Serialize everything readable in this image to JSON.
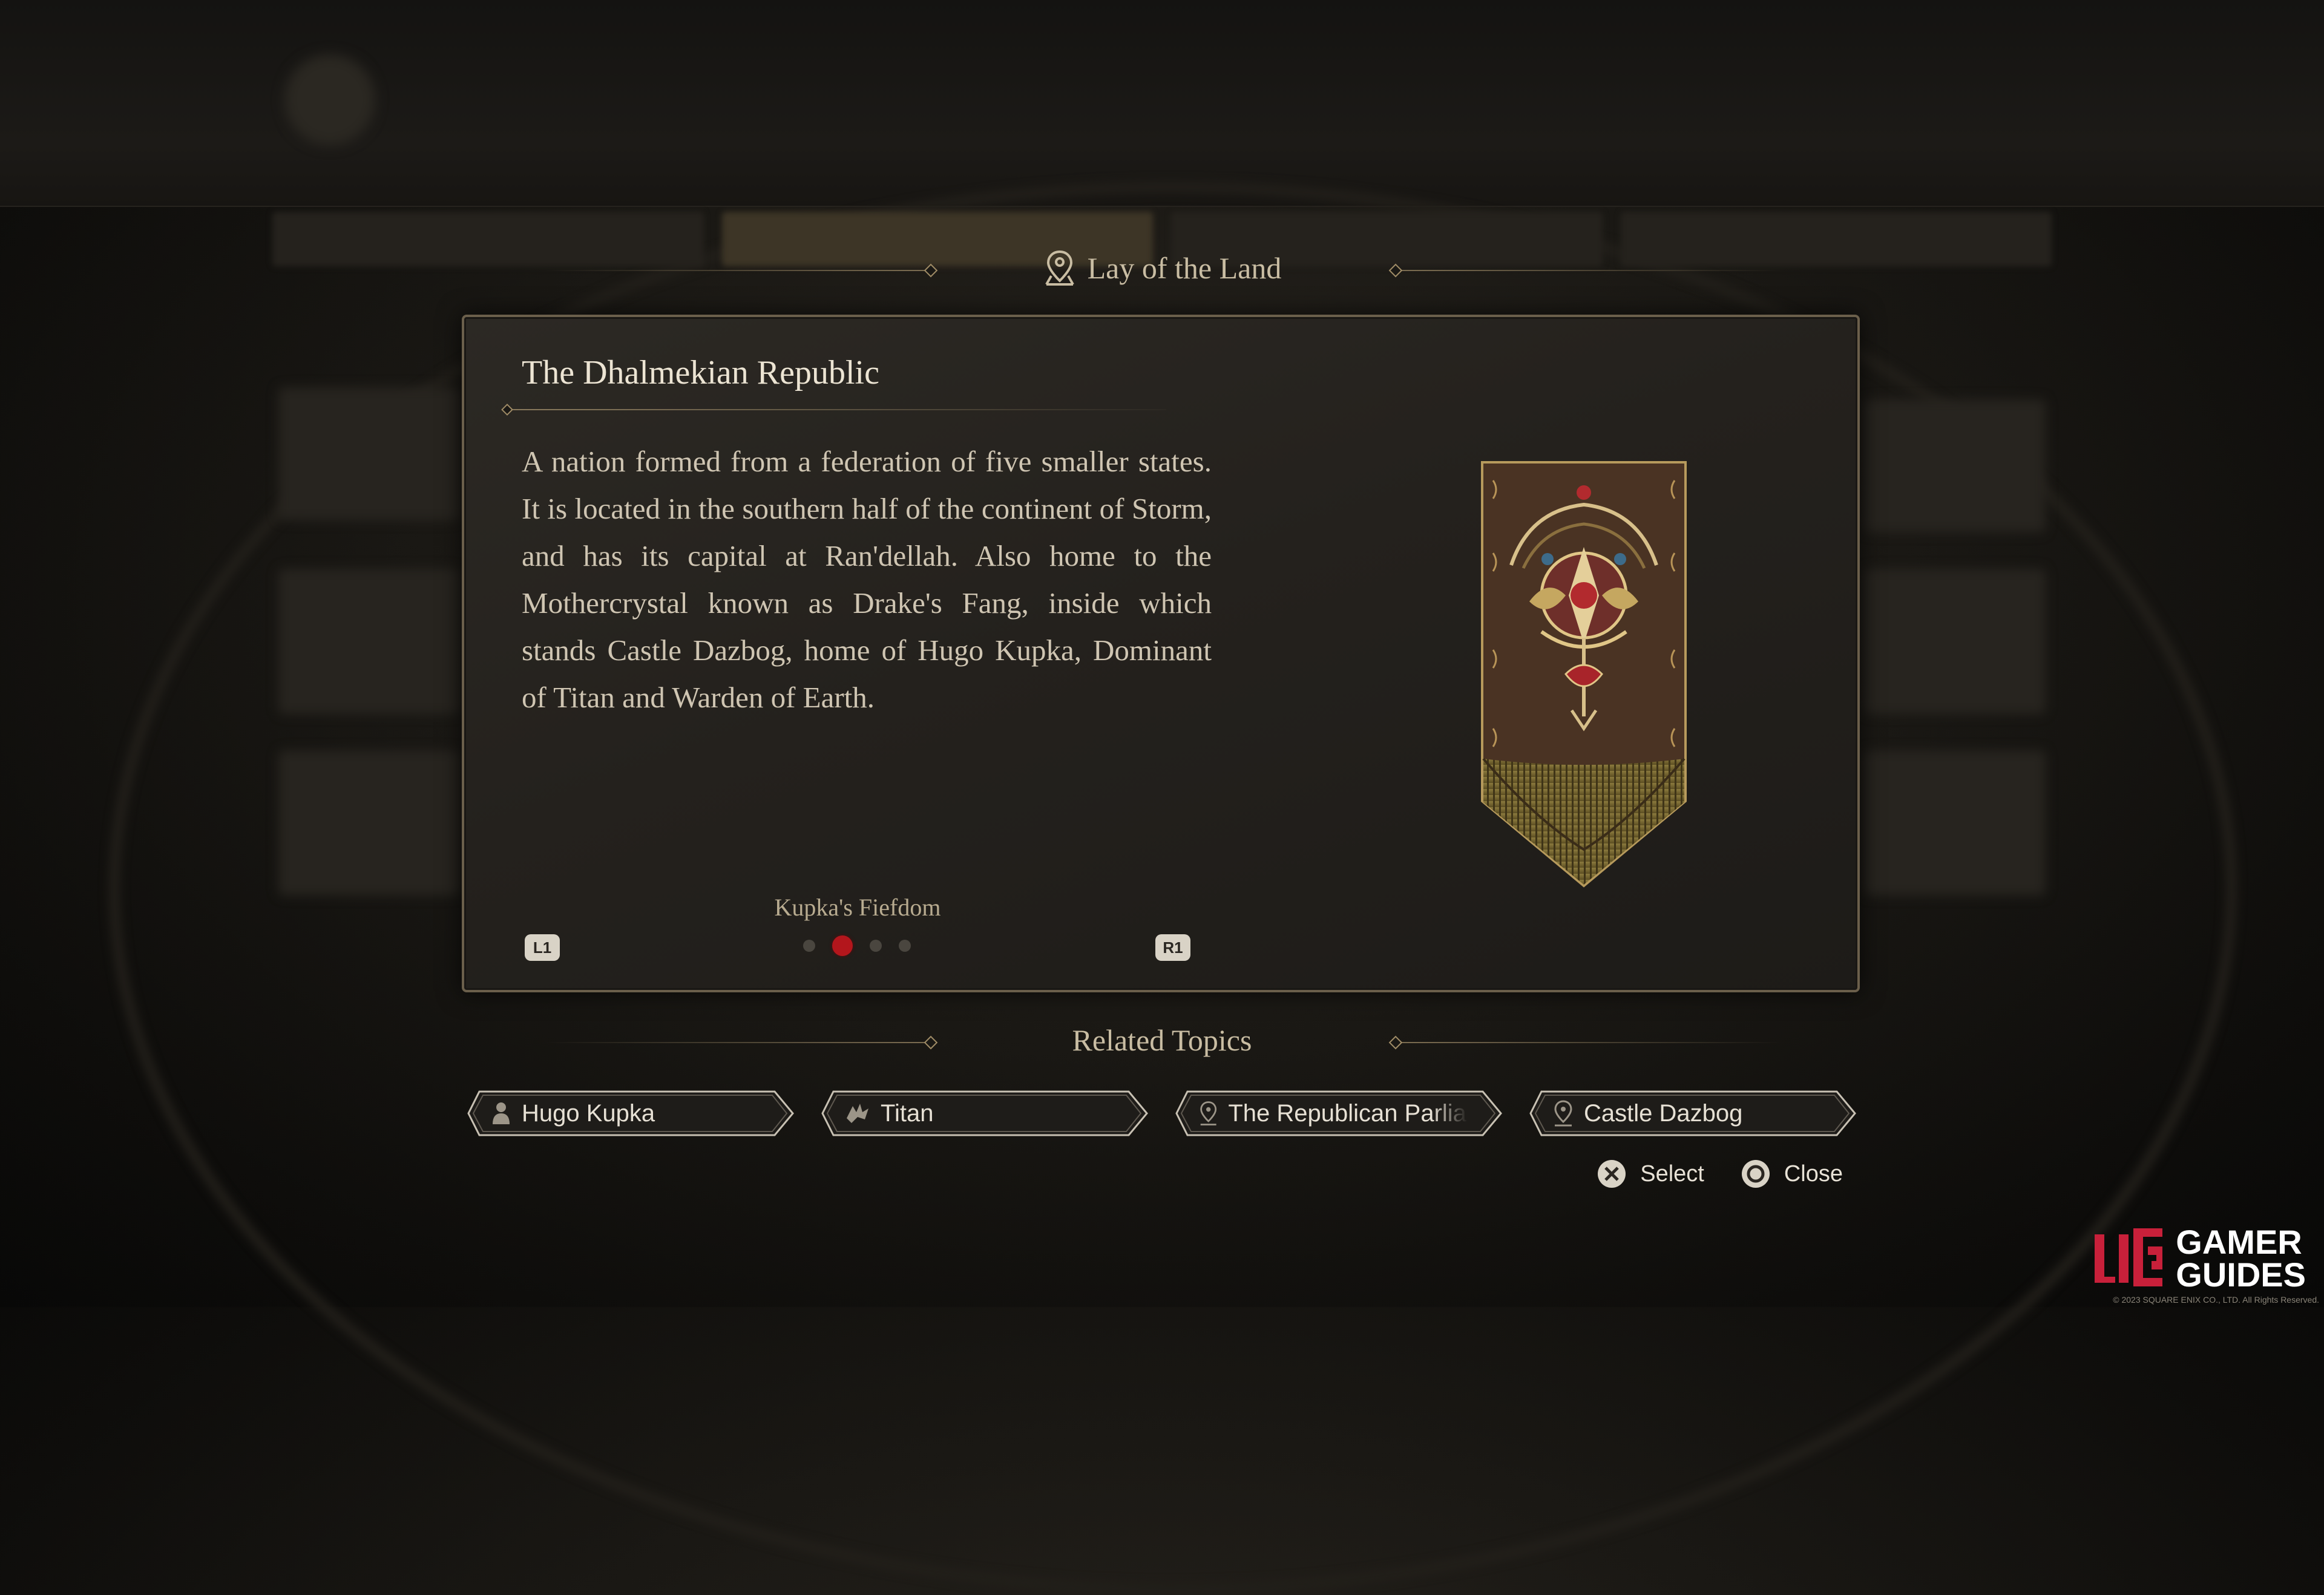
{
  "header": {
    "section_title": "Lay of the Land"
  },
  "entry": {
    "title": "The Dhalmekian Republic",
    "body": "A nation formed from a federation of five smaller states. It is located in the southern half of the continent of Storm, and has its capital at Ran'dellah. Also home to the Mothercrystal known as Drake's Fang, inside which stands Castle Dazbog, home of Hugo Kupka, Dominant of Titan and Warden of Earth.",
    "subtitle": "Kupka's Fiefdom",
    "page_current": 2,
    "page_total": 4,
    "prev_button": "L1",
    "next_button": "R1",
    "emblem": "dhalmekian-banner"
  },
  "related": {
    "title": "Related Topics",
    "topics": [
      {
        "label": "Hugo Kupka",
        "icon": "person-icon"
      },
      {
        "label": "Titan",
        "icon": "eikon-icon"
      },
      {
        "label": "The Republican Parliam",
        "icon": "location-pin-icon"
      },
      {
        "label": "Castle Dazbog",
        "icon": "location-pin-icon"
      }
    ]
  },
  "controls": {
    "select_label": "Select",
    "close_label": "Close"
  },
  "watermark": {
    "line1": "GAMER",
    "line2": "GUIDES",
    "copyright": "© 2023 SQUARE ENIX CO., LTD. All Rights Reserved."
  },
  "colors": {
    "accent_gold": "#a08c66",
    "active_dot": "#b3161c",
    "panel_border": "#6b5f4b",
    "watermark_red": "#c8203a"
  }
}
